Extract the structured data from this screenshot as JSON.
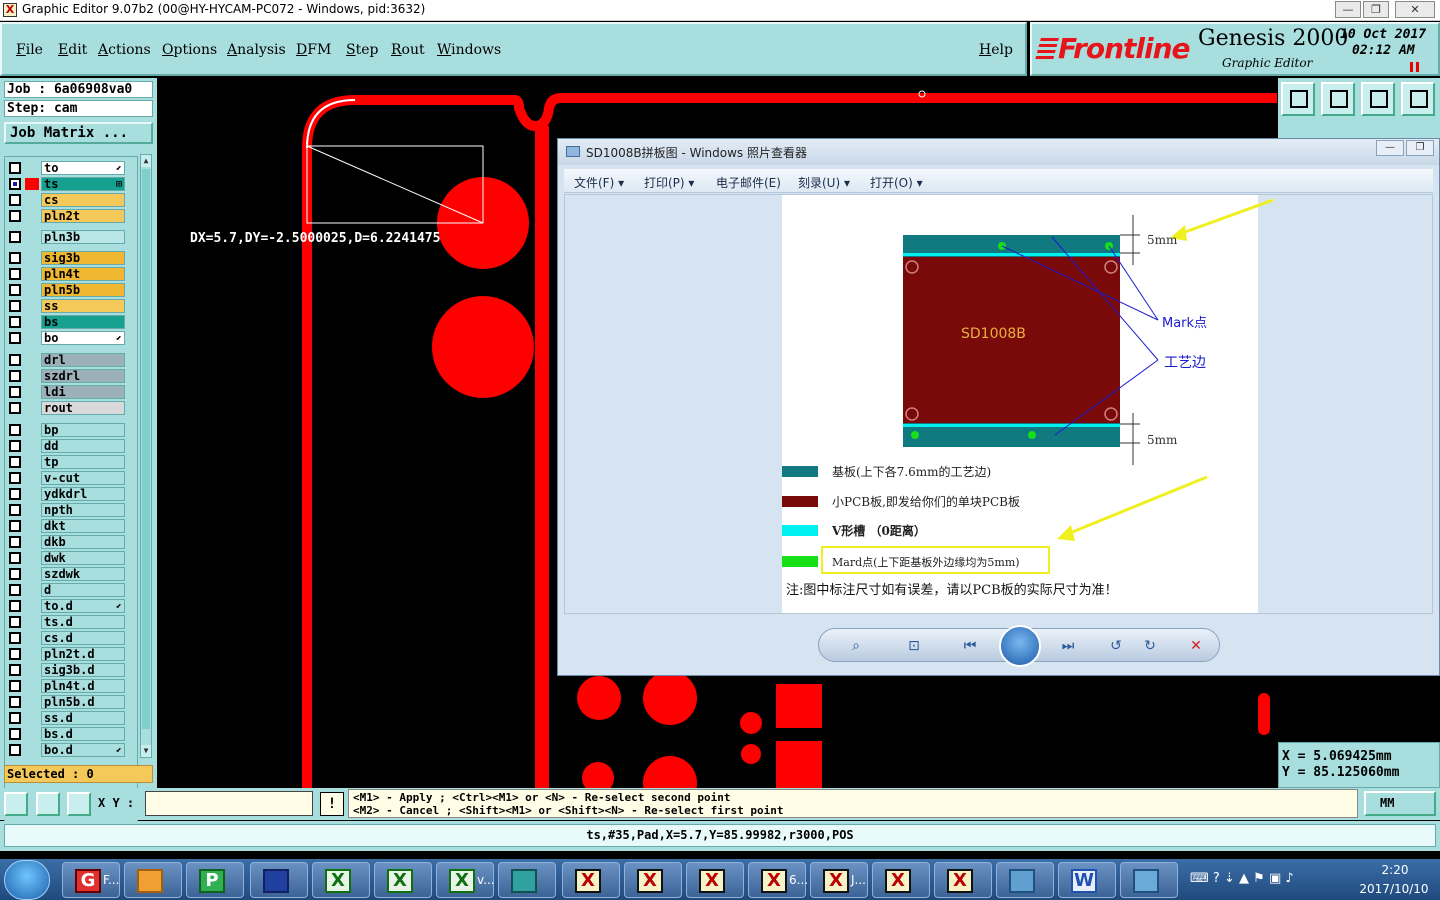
{
  "window": {
    "title": "Graphic Editor 9.07b2 (00@HY-HYCAM-PC072 - Windows, pid:3632)",
    "min": "—",
    "max": "❐",
    "close": "✕"
  },
  "menu": {
    "items": [
      "File",
      "Edit",
      "Actions",
      "Options",
      "Analysis",
      "DFM",
      "Step",
      "Rout",
      "Windows"
    ],
    "help": "Help"
  },
  "brand": {
    "logo": "Frontline",
    "product": "Genesis 2000",
    "subtitle": "Graphic Editor",
    "date": "10 Oct 2017",
    "time": "02:12 AM"
  },
  "job": {
    "job_label": "Job : 6a06908va0",
    "step_label": "Step: cam",
    "matrix_button": "Job Matrix ..."
  },
  "layers": [
    {
      "name": "to",
      "color": "#ffffff",
      "flag": "⬋"
    },
    {
      "name": "ts",
      "color": "#16a090",
      "flag": "⊞",
      "selected": true
    },
    {
      "name": "cs",
      "color": "#f5c85a"
    },
    {
      "name": "pln2t",
      "color": "#f5c85a"
    },
    {
      "name": "pln3b",
      "color": "#b8e6e6"
    },
    {
      "name": "sig3b",
      "color": "#f0b830"
    },
    {
      "name": "pln4t",
      "color": "#f0b830"
    },
    {
      "name": "pln5b",
      "color": "#f0b830"
    },
    {
      "name": "ss",
      "color": "#f5c85a"
    },
    {
      "name": "bs",
      "color": "#16a090"
    },
    {
      "name": "bo",
      "color": "#ffffff",
      "flag": "⬋"
    },
    {
      "name": "drl",
      "color": "#9bb0b8"
    },
    {
      "name": "szdrl",
      "color": "#9bb0b8"
    },
    {
      "name": "ldi",
      "color": "#9bb0b8"
    },
    {
      "name": "rout",
      "color": "#d9d9d9"
    },
    {
      "name": "bp",
      "color": "#a9dede"
    },
    {
      "name": "dd",
      "color": "#a9dede"
    },
    {
      "name": "tp",
      "color": "#a9dede"
    },
    {
      "name": "v-cut",
      "color": "#a9dede"
    },
    {
      "name": "ydkdrl",
      "color": "#a9dede"
    },
    {
      "name": "npth",
      "color": "#a9dede"
    },
    {
      "name": "dkt",
      "color": "#a9dede"
    },
    {
      "name": "dkb",
      "color": "#a9dede"
    },
    {
      "name": "dwk",
      "color": "#a9dede"
    },
    {
      "name": "szdwk",
      "color": "#a9dede"
    },
    {
      "name": "d",
      "color": "#a9dede"
    },
    {
      "name": "to.d",
      "color": "#a9dede",
      "flag": "⬋"
    },
    {
      "name": "ts.d",
      "color": "#a9dede"
    },
    {
      "name": "cs.d",
      "color": "#a9dede"
    },
    {
      "name": "pln2t.d",
      "color": "#a9dede"
    },
    {
      "name": "sig3b.d",
      "color": "#a9dede"
    },
    {
      "name": "pln4t.d",
      "color": "#a9dede"
    },
    {
      "name": "pln5b.d",
      "color": "#a9dede"
    },
    {
      "name": "ss.d",
      "color": "#a9dede"
    },
    {
      "name": "bs.d",
      "color": "#a9dede"
    },
    {
      "name": "bo.d",
      "color": "#a9dede",
      "flag": "⬋"
    }
  ],
  "selected_label": "Selected : 0",
  "canvas": {
    "measure": "DX=5.7,DY=-2.5000025,D=6.2241475"
  },
  "coords": {
    "x": "X = 5.069425mm",
    "y": "Y = 85.125060mm"
  },
  "viewer": {
    "title": "SD1008B拼板图 - Windows 照片查看器",
    "menu": [
      "文件(F) ▾",
      "打印(P) ▾",
      "电子邮件(E)",
      "刻录(U) ▾",
      "打开(O) ▾"
    ],
    "diagram": {
      "board_label": "SD1008B",
      "top_dim": "5mm",
      "bottom_dim": "5mm",
      "mark_label": "Mark点",
      "edge_label": "工艺边",
      "legend": [
        {
          "color": "#117a80",
          "text": "基板(上下各7.6mm的工艺边)"
        },
        {
          "color": "#7a0a0a",
          "text": "小PCB板,即发给你们的单块PCB板"
        },
        {
          "color": "#00f0f0",
          "text": "V形槽 （0距离）"
        },
        {
          "color": "#18e018",
          "text": "Mard点(上下距基板外边缘均为5mm)"
        }
      ],
      "note": "注:图中标注尺寸如有误差，请以PCB板的实际尺寸为准！"
    }
  },
  "command": {
    "xy_label": "X Y :",
    "xy_value": "",
    "exclaim": "!",
    "hint_line1": "<M1> - Apply  ; <Ctrl><M1> or <N> - Re-select second point",
    "hint_line2": "<M2> - Cancel ; <Shift><M1> or <Shift><N> - Re-select first point",
    "units": "MM"
  },
  "status": "ts,#35,Pad,X=5.7,Y=85.99982,r3000,POS",
  "taskbar": {
    "labels": [
      "F...",
      "6...",
      "J...",
      "v..."
    ],
    "time": "2:20",
    "date": "2017/10/10"
  }
}
